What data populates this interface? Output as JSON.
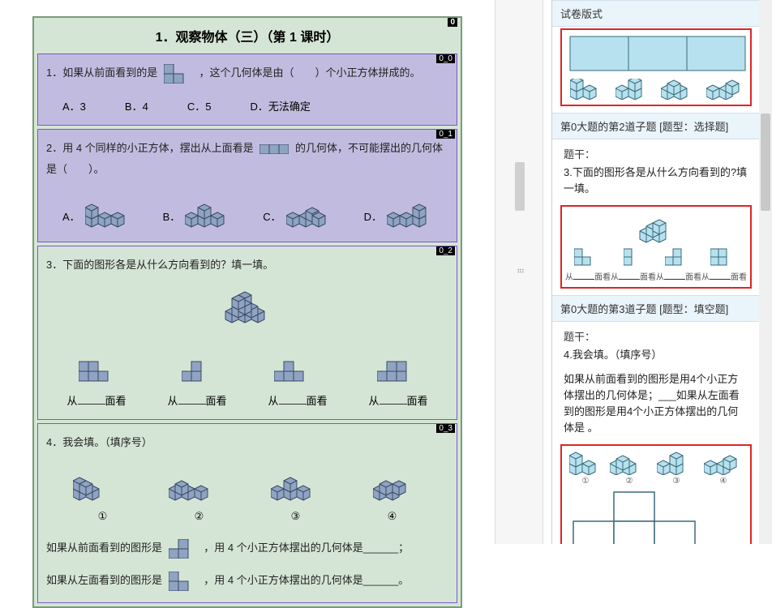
{
  "left": {
    "page_title": "1．观察物体（三）（第 1 课时）",
    "page_badge": "0",
    "questions": [
      {
        "badge": "0_0",
        "stem_pre": "1．如果从前面看到的是",
        "stem_post": "，这个几何体是由（　　）个小正方体拼成的。",
        "options": [
          "A．3",
          "B．4",
          "C．5",
          "D．无法确定"
        ]
      },
      {
        "badge": "0_1",
        "stem_pre": "2．用 4 个同样的小正方体，摆出从上面看是",
        "stem_mid": "的几何体，不可能摆出的几何体",
        "stem_post": "是（　　）。",
        "options": [
          "A．",
          "B．",
          "C．",
          "D．"
        ]
      },
      {
        "badge": "0_2",
        "stem": "3．下面的图形各是从什么方向看到的？填一填。",
        "fill_labels": [
          "从",
          "面看",
          "从",
          "面看",
          "从",
          "面看",
          "从",
          "面看"
        ]
      },
      {
        "badge": "0_3",
        "stem": "4．我会填。（填序号）",
        "circ_labels": [
          "①",
          "②",
          "③",
          "④"
        ],
        "line2_pre": "如果从前面看到的图形是",
        "line2_post": "，用 4 个小正方体摆出的几何体是______；",
        "line3_pre": "如果从左面看到的图形是",
        "line3_post": "，用 4 个小正方体摆出的几何体是______。"
      }
    ]
  },
  "right": {
    "top_label": "试卷版式",
    "sub2": {
      "header": "第0大题的第2道子题 [题型：选择题]",
      "stem_label": "题干：",
      "stem_text": "3.下面的图形各是从什么方向看到的?填一填。",
      "caps": [
        "从",
        "面看",
        "从",
        "面看",
        "从",
        "面看",
        "从",
        "面看"
      ]
    },
    "sub3": {
      "header": "第0大题的第3道子题 [题型：填空题]",
      "stem_label": "题干：",
      "line1": "4.我会填。（填序号）",
      "line2": "如果从前面看到的图形是用4个小正方体摆出的几何体是；___如果从左面看到的图形是用4个小正方体摆出的几何体是 。",
      "circ": [
        "①",
        "②",
        "③",
        "④"
      ]
    }
  }
}
